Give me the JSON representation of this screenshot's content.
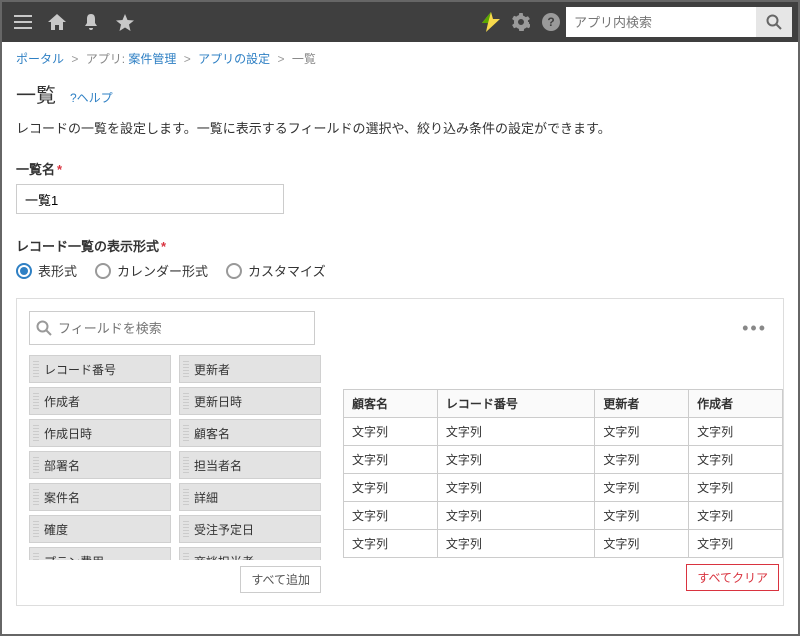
{
  "topbar": {
    "search_placeholder": "アプリ内検索"
  },
  "breadcrumb": {
    "portal": "ポータル",
    "app_prefix": "アプリ:",
    "app_name": "案件管理",
    "settings": "アプリの設定",
    "current": "一覧"
  },
  "page": {
    "title": "一覧",
    "help": "?ヘルプ",
    "description": "レコードの一覧を設定します。一覧に表示するフィールドの選択や、絞り込み条件の設定ができます。"
  },
  "name_field": {
    "label": "一覧名",
    "value": "一覧1"
  },
  "display_format": {
    "label": "レコード一覧の表示形式",
    "options": {
      "table": "表形式",
      "calendar": "カレンダー形式",
      "custom": "カスタマイズ"
    }
  },
  "builder": {
    "field_search_placeholder": "フィールドを検索",
    "add_all": "すべて追加",
    "clear_all": "すべてクリア"
  },
  "palette": [
    "レコード番号",
    "更新者",
    "作成者",
    "更新日時",
    "作成日時",
    "顧客名",
    "部署名",
    "担当者名",
    "案件名",
    "詳細",
    "確度",
    "受注予定日",
    "プラン費用",
    "商談担当者"
  ],
  "preview": {
    "headers": [
      "顧客名",
      "レコード番号",
      "更新者",
      "作成者"
    ],
    "cell": "文字列",
    "rows": 5
  }
}
